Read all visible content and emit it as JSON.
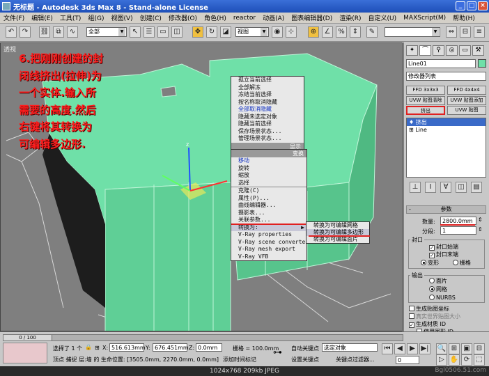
{
  "window": {
    "title": "无标题 - Autodesk 3ds Max 8 - Stand-alone License"
  },
  "menu": [
    "文件(F)",
    "编辑(E)",
    "工具(T)",
    "组(G)",
    "视图(V)",
    "创建(C)",
    "修改器(O)",
    "角色(H)",
    "reactor",
    "动画(A)",
    "图表编辑器(D)",
    "渲染(R)",
    "自定义(U)",
    "MAXScript(M)",
    "帮助(H)"
  ],
  "toolbar": {
    "selection_filter": "全部",
    "ref_coord": "视图"
  },
  "viewport": {
    "label": "透视",
    "annotation": [
      "6.把刚刚创建的封",
      "闭线挤出(拉伸)为",
      "一个实体.输入所",
      "需要的高度.然后",
      "右键将其转换为",
      "可编辑多边形."
    ]
  },
  "quadmenu": {
    "top_items": [
      "孤立当前选择",
      "全部解冻",
      "冻结当前选择",
      "按名称取消隐藏",
      "全部取消隐藏",
      "隐藏未选定对象",
      "隐藏当前选择",
      "保存场景状态...",
      "管理场景状态..."
    ],
    "display_label": "显示",
    "transform_label": "变换",
    "transform_items": [
      "移动",
      "旋转",
      "缩放",
      "选择",
      "克隆(C)",
      "属性(P)...",
      "曲线编辑器...",
      "摄影表...",
      "关联参数...",
      "转换为:",
      "V-Ray properties",
      "V-Ray scene converter",
      "V-Ray mesh export",
      "V-Ray VFB"
    ],
    "submenu": [
      "转换为可编辑网格",
      "转换为可编辑多边形",
      "转换为可编辑面片"
    ]
  },
  "cmdpanel": {
    "object_name": "Line01",
    "modifier_list": "修改器列表",
    "buttons": [
      "FFD 3x3x3",
      "FFD 4x4x4",
      "UVW 贴图清除",
      "UVW 贴图添加",
      "挤出",
      "UVW 贴图"
    ],
    "stack": [
      "挤出",
      "Line"
    ],
    "rollout_title": "参数",
    "amount_label": "数量:",
    "amount_value": "2800.0mm",
    "segments_label": "分段:",
    "segments_value": "1",
    "cap_label": "封口",
    "cap_start": "封口始端",
    "cap_end": "封口末端",
    "morph": "变形",
    "grid": "栅格",
    "output_label": "输出",
    "out_patch": "面片",
    "out_mesh": "网格",
    "out_nurbs": "NURBS",
    "gen_map": "生成贴图坐标",
    "real_world": "真实世界贴图大小",
    "gen_mat": "生成材质 ID",
    "use_shape": "使用图形 ID"
  },
  "status": {
    "timeline": "0 / 100",
    "selected": "选择了 1 个",
    "x_label": "X:",
    "x": "516.613mm",
    "y_label": "Y:",
    "y": "676.451mm",
    "z_label": "Z:",
    "z": "0.0mm",
    "grid": "栅格 = 100.0mm",
    "autokey": "自动关键点",
    "selected_obj": "选定对象",
    "setkey": "设置关键点",
    "keyfilter": "关键点过滤器...",
    "prompt": "顶点 捕捉 层:墙 的 生命位置: [3505.0mm, 2270.0mm, 0.0mm]",
    "add_time_tag": "添加时间标记",
    "frame": "0"
  },
  "caption": "1024x768  209kb  JPEG",
  "watermark": "Bgl0506.51.com",
  "colors": {
    "mesh": "#6fe0a8",
    "annotation": "#ff1e1e"
  }
}
